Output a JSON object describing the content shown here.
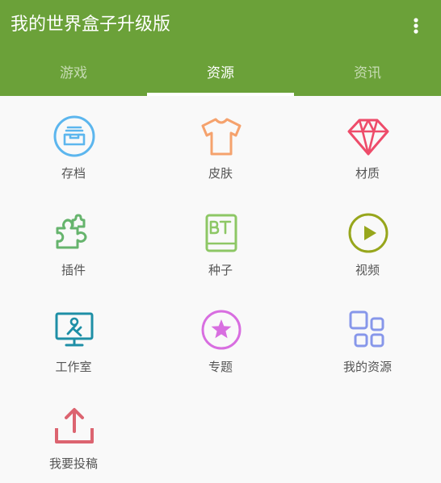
{
  "app": {
    "title": "我的世界盒子升级版",
    "menu_icon": "more-vertical-icon"
  },
  "tabs": [
    {
      "label": "游戏",
      "active": false
    },
    {
      "label": "资源",
      "active": true
    },
    {
      "label": "资讯",
      "active": false
    }
  ],
  "colors": {
    "appbar": "#6ba139",
    "archive": "#5cb6ee",
    "skin": "#f5a26d",
    "material": "#ee4c6a",
    "plugin": "#66b46d",
    "seed": "#8dc765",
    "video": "#97a61c",
    "studio": "#1e8fa6",
    "topic": "#d86ee0",
    "my_resources": "#8797ea",
    "submit": "#dc6470"
  },
  "grid": {
    "items": [
      {
        "label": "存档",
        "icon": "archive-tray-icon"
      },
      {
        "label": "皮肤",
        "icon": "tshirt-icon"
      },
      {
        "label": "材质",
        "icon": "diamond-icon"
      },
      {
        "label": "插件",
        "icon": "puzzle-piece-icon"
      },
      {
        "label": "种子",
        "icon": "bt-book-icon"
      },
      {
        "label": "视频",
        "icon": "play-circle-icon"
      },
      {
        "label": "工作室",
        "icon": "monitor-tools-icon"
      },
      {
        "label": "专题",
        "icon": "star-circle-icon"
      },
      {
        "label": "我的资源",
        "icon": "grid-squares-icon"
      },
      {
        "label": "我要投稿",
        "icon": "upload-tray-icon"
      }
    ]
  }
}
